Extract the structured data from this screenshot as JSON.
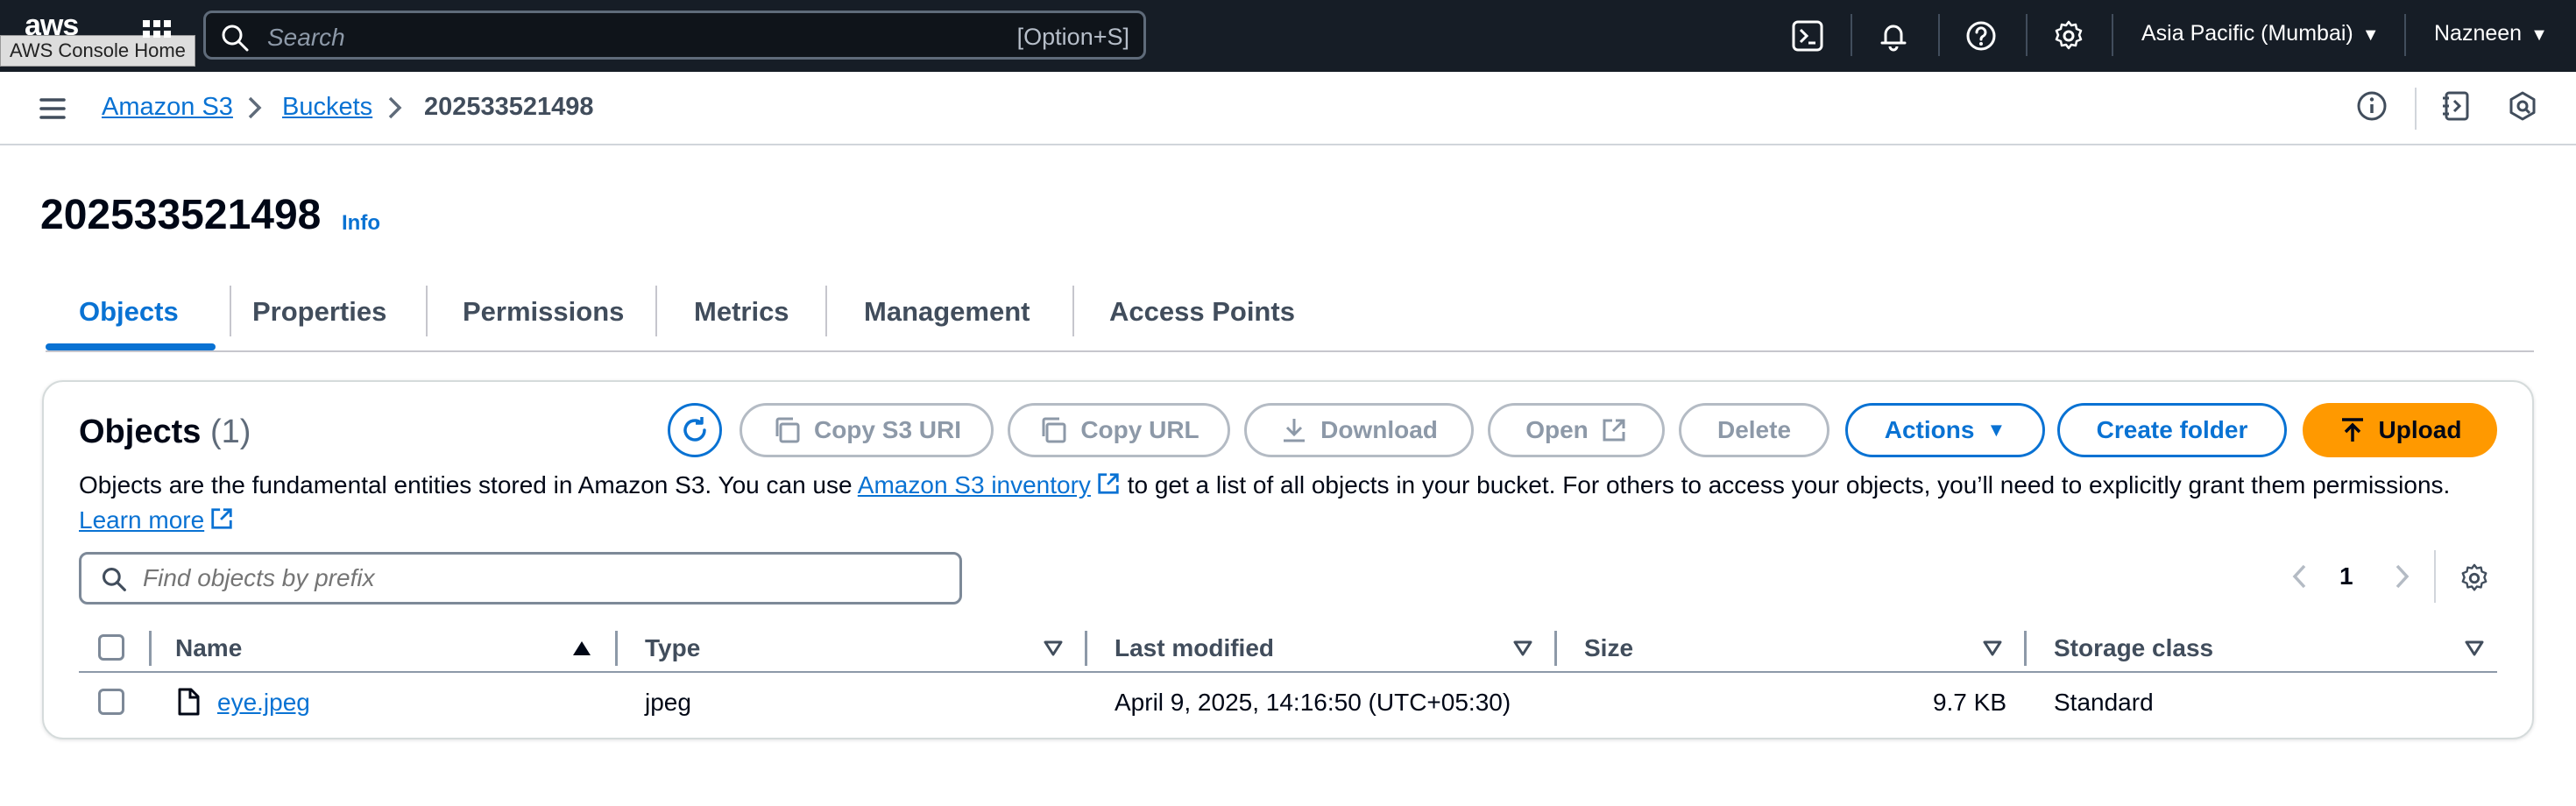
{
  "topnav": {
    "logo": "aws",
    "logo_tooltip": "AWS Console Home",
    "search_placeholder": "Search",
    "search_shortcut": "[Option+S]",
    "region": "Asia Pacific (Mumbai)",
    "user": "Nazneen"
  },
  "breadcrumb": {
    "items": [
      "Amazon S3",
      "Buckets"
    ],
    "current": "202533521498"
  },
  "page": {
    "title": "202533521498",
    "info": "Info"
  },
  "tabs": [
    "Objects",
    "Properties",
    "Permissions",
    "Metrics",
    "Management",
    "Access Points"
  ],
  "objects": {
    "title": "Objects",
    "count": "(1)",
    "buttons": {
      "copy_s3_uri": "Copy S3 URI",
      "copy_url": "Copy URL",
      "download": "Download",
      "open": "Open",
      "delete": "Delete",
      "actions": "Actions",
      "create_folder": "Create folder",
      "upload": "Upload"
    },
    "description_part1": "Objects are the fundamental entities stored in Amazon S3. You can use ",
    "inventory_link": "Amazon S3 inventory",
    "description_part2": " to get a list of all objects in your bucket. For others to access your objects, you’ll need to explicitly grant them permissions. ",
    "learn_more": "Learn more",
    "filter_placeholder": "Find objects by prefix",
    "page_number": "1",
    "columns": [
      "Name",
      "Type",
      "Last modified",
      "Size",
      "Storage class"
    ],
    "rows": [
      {
        "name": "eye.jpeg",
        "type": "jpeg",
        "last_modified": "April 9, 2025, 14:16:50 (UTC+05:30)",
        "size": "9.7 KB",
        "storage_class": "Standard"
      }
    ]
  },
  "colors": {
    "nav_bg": "#161d26",
    "link": "#0972d3",
    "upload": "#ff9900"
  }
}
